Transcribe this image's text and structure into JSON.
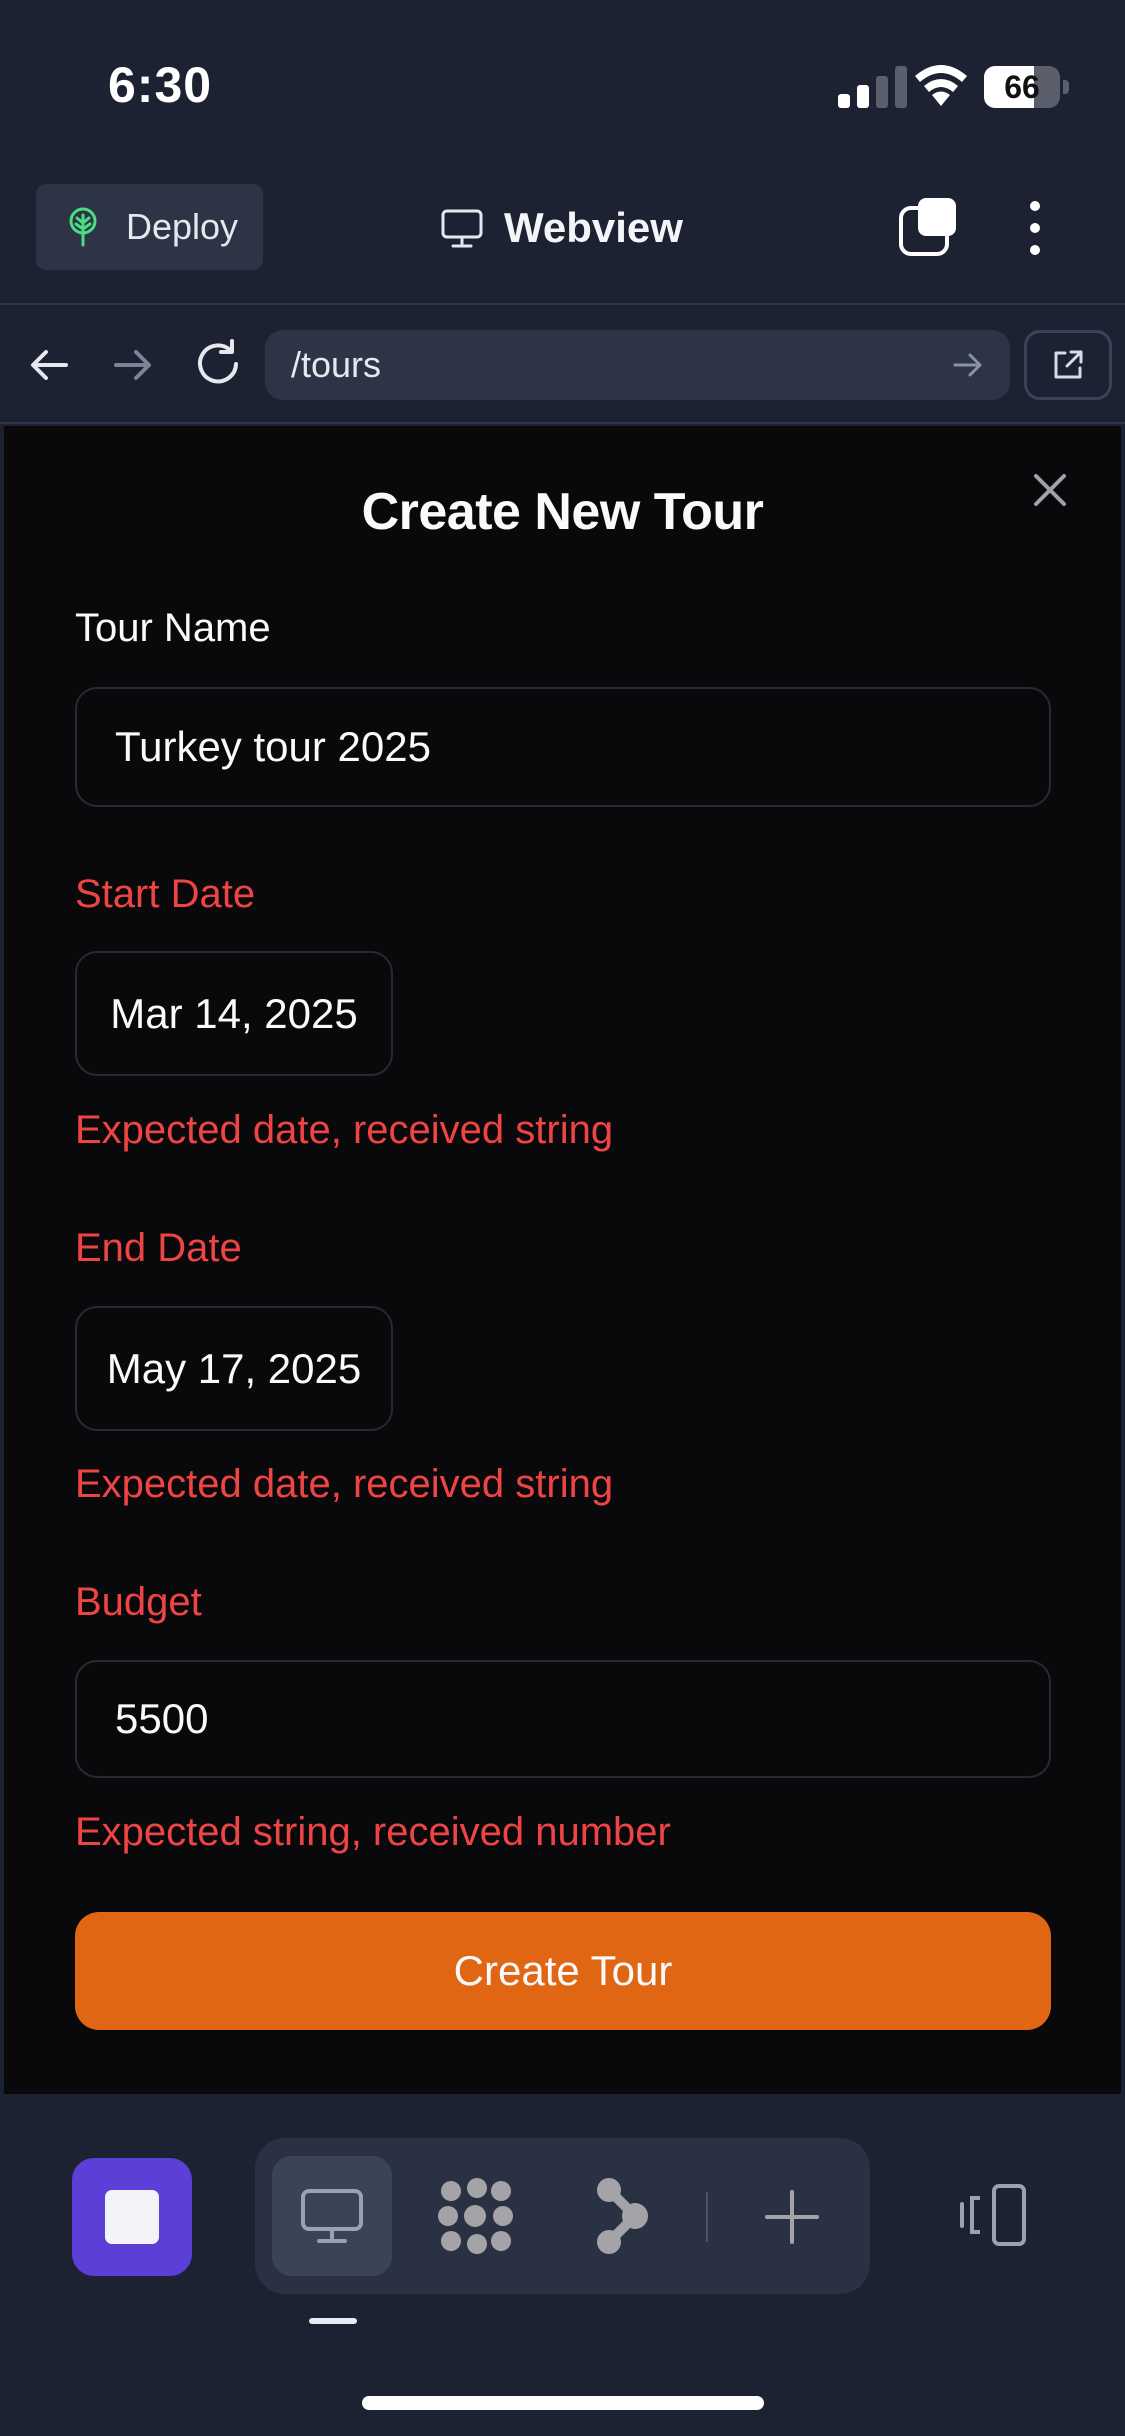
{
  "status_bar": {
    "time": "6:30",
    "battery_percent": "66",
    "battery_level": 0.66,
    "signal_bars": 2
  },
  "top_bar": {
    "deploy_label": "Deploy",
    "title": "Webview",
    "deploy_icon": "tree-icon",
    "title_icon": "monitor-icon"
  },
  "nav_bar": {
    "url": "/tours"
  },
  "form": {
    "title": "Create New Tour",
    "fields": {
      "tour_name": {
        "label": "Tour Name",
        "value": "Turkey tour 2025"
      },
      "start_date": {
        "label": "Start Date",
        "value": "Mar 14, 2025",
        "error": "Expected date, received string"
      },
      "end_date": {
        "label": "End Date",
        "value": "May 17, 2025",
        "error": "Expected date, received string"
      },
      "budget": {
        "label": "Budget",
        "value": "5500",
        "error": "Expected string, received number"
      }
    },
    "submit_label": "Create Tour"
  },
  "colors": {
    "accent": "#e06614",
    "error": "#ef4444",
    "stop": "#5b3fd6",
    "background": "#09090b",
    "chrome": "#1c2232"
  },
  "toolbar": {
    "modes": [
      "monitor-icon",
      "grid-icon",
      "flow-icon",
      "plus-icon"
    ],
    "active_mode": "monitor-icon"
  }
}
